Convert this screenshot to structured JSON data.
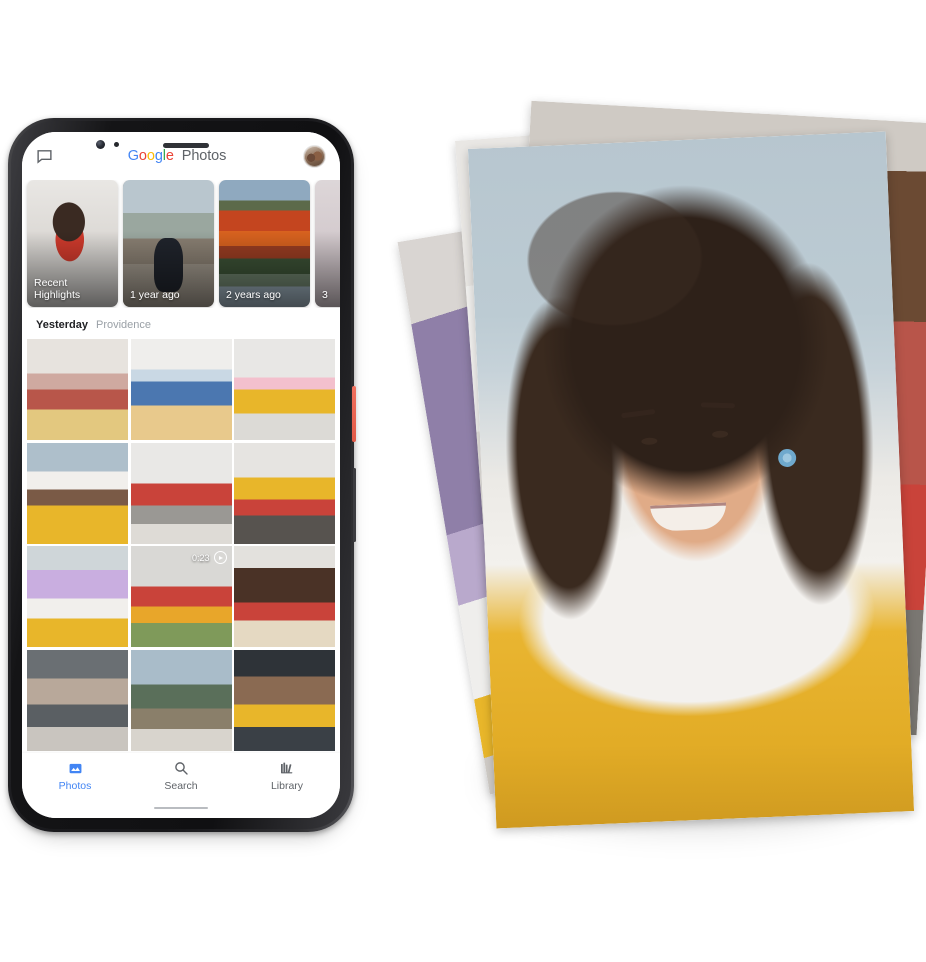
{
  "scene": {
    "description": "Google Photos mobile app shown on a phone beside a stack of printed photographs",
    "background_color": "#ffffff"
  },
  "phone": {
    "device_name": "smartphone-mockup",
    "frame_color": "#1b1b1e",
    "power_button_color": "#ef6f5d",
    "app": {
      "app_bar": {
        "chat_icon": "chat-bubble-icon",
        "title_brand": "Google",
        "title_brand_letters": [
          "G",
          "o",
          "o",
          "g",
          "l",
          "e"
        ],
        "title_product": "Photos",
        "brand_colors": [
          "#4285F4",
          "#EA4335",
          "#FBBC05",
          "#4285F4",
          "#34A853",
          "#EA4335"
        ],
        "product_color": "#5F6368",
        "avatar": "user-avatar"
      },
      "memories": [
        {
          "label": "Recent\nHighlights",
          "label_line1": "Recent",
          "label_line2": "Highlights",
          "art": "mem0"
        },
        {
          "label": "1 year ago",
          "label_line1": "1 year ago",
          "label_line2": "",
          "art": "mem1"
        },
        {
          "label": "2 years ago",
          "label_line1": "2 years ago",
          "label_line2": "",
          "art": "mem2"
        },
        {
          "label": "3",
          "label_line1": "3",
          "label_line2": "",
          "art": "mem3"
        }
      ],
      "section": {
        "date": "Yesterday",
        "place": "Providence"
      },
      "grid": [
        {
          "art": "p-a",
          "video": false
        },
        {
          "art": "p-b",
          "video": false
        },
        {
          "art": "p-c",
          "video": false
        },
        {
          "art": "p-d",
          "video": false
        },
        {
          "art": "p-e",
          "video": false
        },
        {
          "art": "p-f",
          "video": false
        },
        {
          "art": "p-g",
          "video": false
        },
        {
          "art": "p-h",
          "video": true,
          "duration": "0:23"
        },
        {
          "art": "p-i",
          "video": false
        },
        {
          "art": "p-j",
          "video": false
        },
        {
          "art": "p-k",
          "video": false
        },
        {
          "art": "p-l",
          "video": false
        }
      ],
      "bottom_nav": {
        "active_color": "#4285F4",
        "inactive_color": "#5F6368",
        "items": [
          {
            "label": "Photos",
            "icon": "photo-mountain-icon",
            "active": true
          },
          {
            "label": "Search",
            "icon": "search-icon",
            "active": false
          },
          {
            "label": "Library",
            "icon": "library-books-icon",
            "active": false
          }
        ]
      }
    }
  },
  "photo_stack": {
    "name": "printed-photo-stack",
    "count": 4,
    "prints": [
      {
        "id": "print-4",
        "rotation_deg": -9.5,
        "subject": "purple balloon indoors"
      },
      {
        "id": "print-3",
        "rotation_deg": -4.2,
        "subject": "child in yellow dress, brick wall"
      },
      {
        "id": "print-2",
        "rotation_deg": 3.2,
        "subject": "child in red top"
      },
      {
        "id": "print-1",
        "rotation_deg": -2.4,
        "subject": "smiling girl in yellow dress with blue flower hair clip"
      }
    ]
  }
}
